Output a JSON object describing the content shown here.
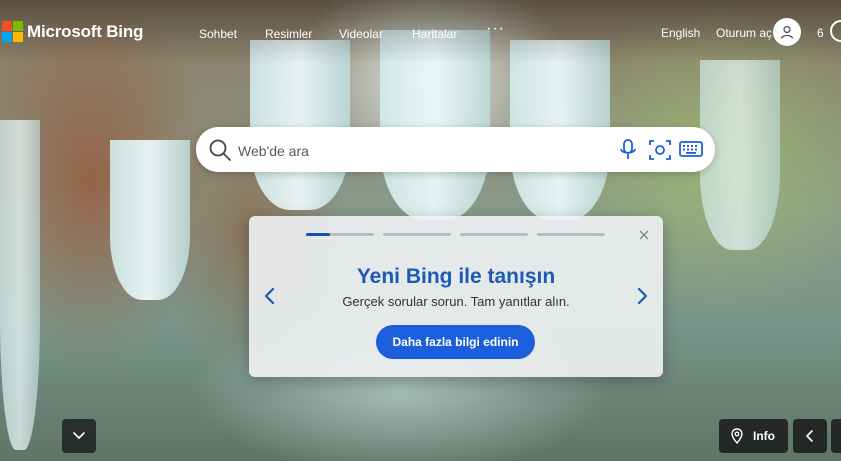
{
  "header": {
    "logo_text": "Microsoft Bing",
    "nav": [
      {
        "label": "Sohbet"
      },
      {
        "label": "Resimler"
      },
      {
        "label": "Videolar"
      },
      {
        "label": "Haritalar"
      }
    ],
    "more": "···",
    "language": "English",
    "sign_in": "Oturum aç",
    "rewards_count": "6"
  },
  "search": {
    "placeholder": "Web'de ara"
  },
  "promo": {
    "title": "Yeni Bing ile tanışın",
    "subtitle": "Gerçek sorular sorun. Tam yanıtlar alın.",
    "button_label": "Daha fazla bilgi edinin",
    "slides_total": 4,
    "active_slide": 1,
    "active_slide_progress": 0.35
  },
  "bottom": {
    "info_label": "Info"
  },
  "colors": {
    "accent": "#1c5fdc",
    "title_blue": "#1d5ab8",
    "ms_red": "#f25022",
    "ms_green": "#7fba00",
    "ms_blue": "#00a4ef",
    "ms_yellow": "#ffb900"
  },
  "icons": {
    "search": "search-icon",
    "mic": "microphone-icon",
    "visual_search": "visual-search-icon",
    "keyboard": "keyboard-icon",
    "close": "close-icon",
    "avatar": "user-icon",
    "location": "location-pin-icon"
  }
}
